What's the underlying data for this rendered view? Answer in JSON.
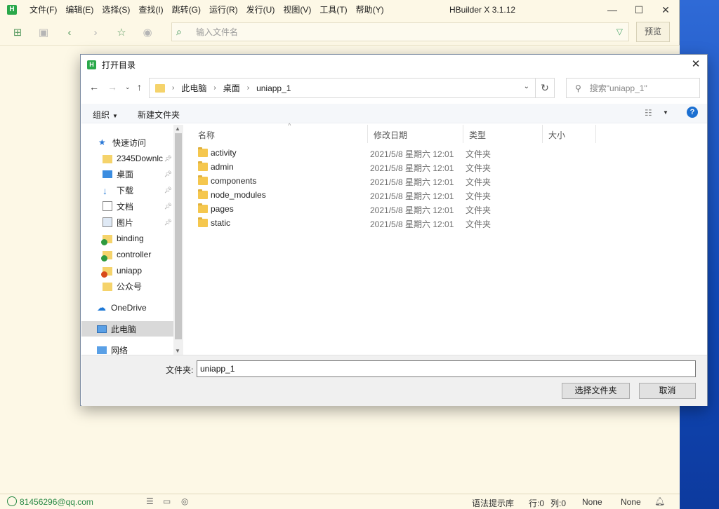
{
  "hbuilder": {
    "logo_letter": "H",
    "menu": [
      "文件(F)",
      "编辑(E)",
      "选择(S)",
      "查找(I)",
      "跳转(G)",
      "运行(R)",
      "发行(U)",
      "视图(V)",
      "工具(T)",
      "帮助(Y)"
    ],
    "title": "HBuilder X 3.1.12",
    "address_placeholder": "输入文件名",
    "preview_label": "预览",
    "status": {
      "account": "81456296@qq.com",
      "syntax_lib": "语法提示库",
      "row": "行:0",
      "col": "列:0",
      "encoding": "None",
      "language": "None"
    }
  },
  "dialog": {
    "logo_letter": "H",
    "title": "打开目录",
    "breadcrumb": [
      "此电脑",
      "桌面",
      "uniapp_1"
    ],
    "search_placeholder": "搜索\"uniapp_1\"",
    "organize_label": "组织",
    "new_folder_label": "新建文件夹",
    "help": "?",
    "tree": {
      "quick_access": "快速访问",
      "items": [
        {
          "label": "2345Downlc",
          "icon": "folder-icon",
          "pinned": true
        },
        {
          "label": "桌面",
          "icon": "desktop-icon",
          "pinned": true
        },
        {
          "label": "下载",
          "icon": "download-icon",
          "pinned": true
        },
        {
          "label": "文档",
          "icon": "document-icon",
          "pinned": true
        },
        {
          "label": "图片",
          "icon": "picture-icon",
          "pinned": true
        },
        {
          "label": "binding",
          "icon": "folder-synced-icon",
          "pinned": false
        },
        {
          "label": "controller",
          "icon": "folder-synced-icon",
          "pinned": false
        },
        {
          "label": "uniapp",
          "icon": "folder-warning-icon",
          "pinned": false
        },
        {
          "label": "公众号",
          "icon": "folder-icon",
          "pinned": false
        }
      ],
      "onedrive": "OneDrive",
      "this_pc": "此电脑",
      "network": "网络"
    },
    "columns": {
      "name": "名称",
      "date": "修改日期",
      "type": "类型",
      "size": "大小"
    },
    "files": [
      {
        "name": "activity",
        "date": "2021/5/8 星期六 12:01",
        "type": "文件夹"
      },
      {
        "name": "admin",
        "date": "2021/5/8 星期六 12:01",
        "type": "文件夹"
      },
      {
        "name": "components",
        "date": "2021/5/8 星期六 12:01",
        "type": "文件夹"
      },
      {
        "name": "node_modules",
        "date": "2021/5/8 星期六 12:01",
        "type": "文件夹"
      },
      {
        "name": "pages",
        "date": "2021/5/8 星期六 12:01",
        "type": "文件夹"
      },
      {
        "name": "static",
        "date": "2021/5/8 星期六 12:01",
        "type": "文件夹"
      }
    ],
    "folder_label": "文件夹:",
    "folder_value": "uniapp_1",
    "select_button": "选择文件夹",
    "cancel_button": "取消"
  }
}
